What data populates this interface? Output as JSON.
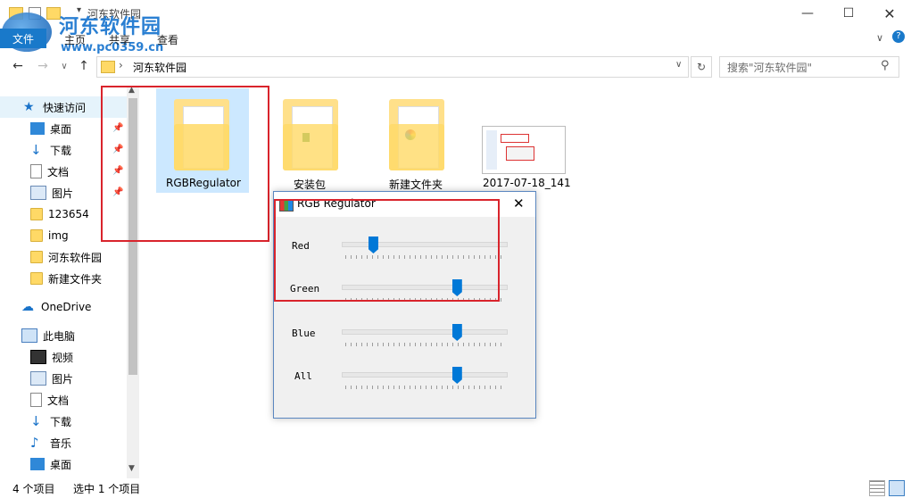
{
  "window": {
    "title": "河东软件园",
    "ribbon_tabs": [
      "文件",
      "主页",
      "共享",
      "查看"
    ],
    "watermark_site": "www.pc0359.cn"
  },
  "address": {
    "path": "河东软件园",
    "search_placeholder": "搜索\"河东软件园\""
  },
  "sidebar": {
    "quick_access": "快速访问",
    "quick_items": [
      "桌面",
      "下载",
      "文档",
      "图片",
      "123654",
      "img",
      "河东软件园",
      "新建文件夹"
    ],
    "onedrive": "OneDrive",
    "this_pc": "此电脑",
    "pc_items": [
      "视频",
      "图片",
      "文档",
      "下载",
      "音乐",
      "桌面"
    ]
  },
  "files": [
    {
      "name": "RGBRegulator",
      "selected": true
    },
    {
      "name": "安装包"
    },
    {
      "name": "新建文件夹"
    },
    {
      "name": "2017-07-18_141"
    }
  ],
  "status": {
    "count": "4 个项目",
    "selection": "选中 1 个项目"
  },
  "dialog": {
    "title": "RGB Regulator",
    "sliders": [
      {
        "label": "Red",
        "value": 0.19
      },
      {
        "label": "Green",
        "value": 0.7
      },
      {
        "label": "Blue",
        "value": 0.7
      },
      {
        "label": "All",
        "value": 0.7
      }
    ]
  },
  "colors": {
    "accent": "#0078d7",
    "highlight_box": "#d9242c",
    "folder": "#ffd966"
  }
}
